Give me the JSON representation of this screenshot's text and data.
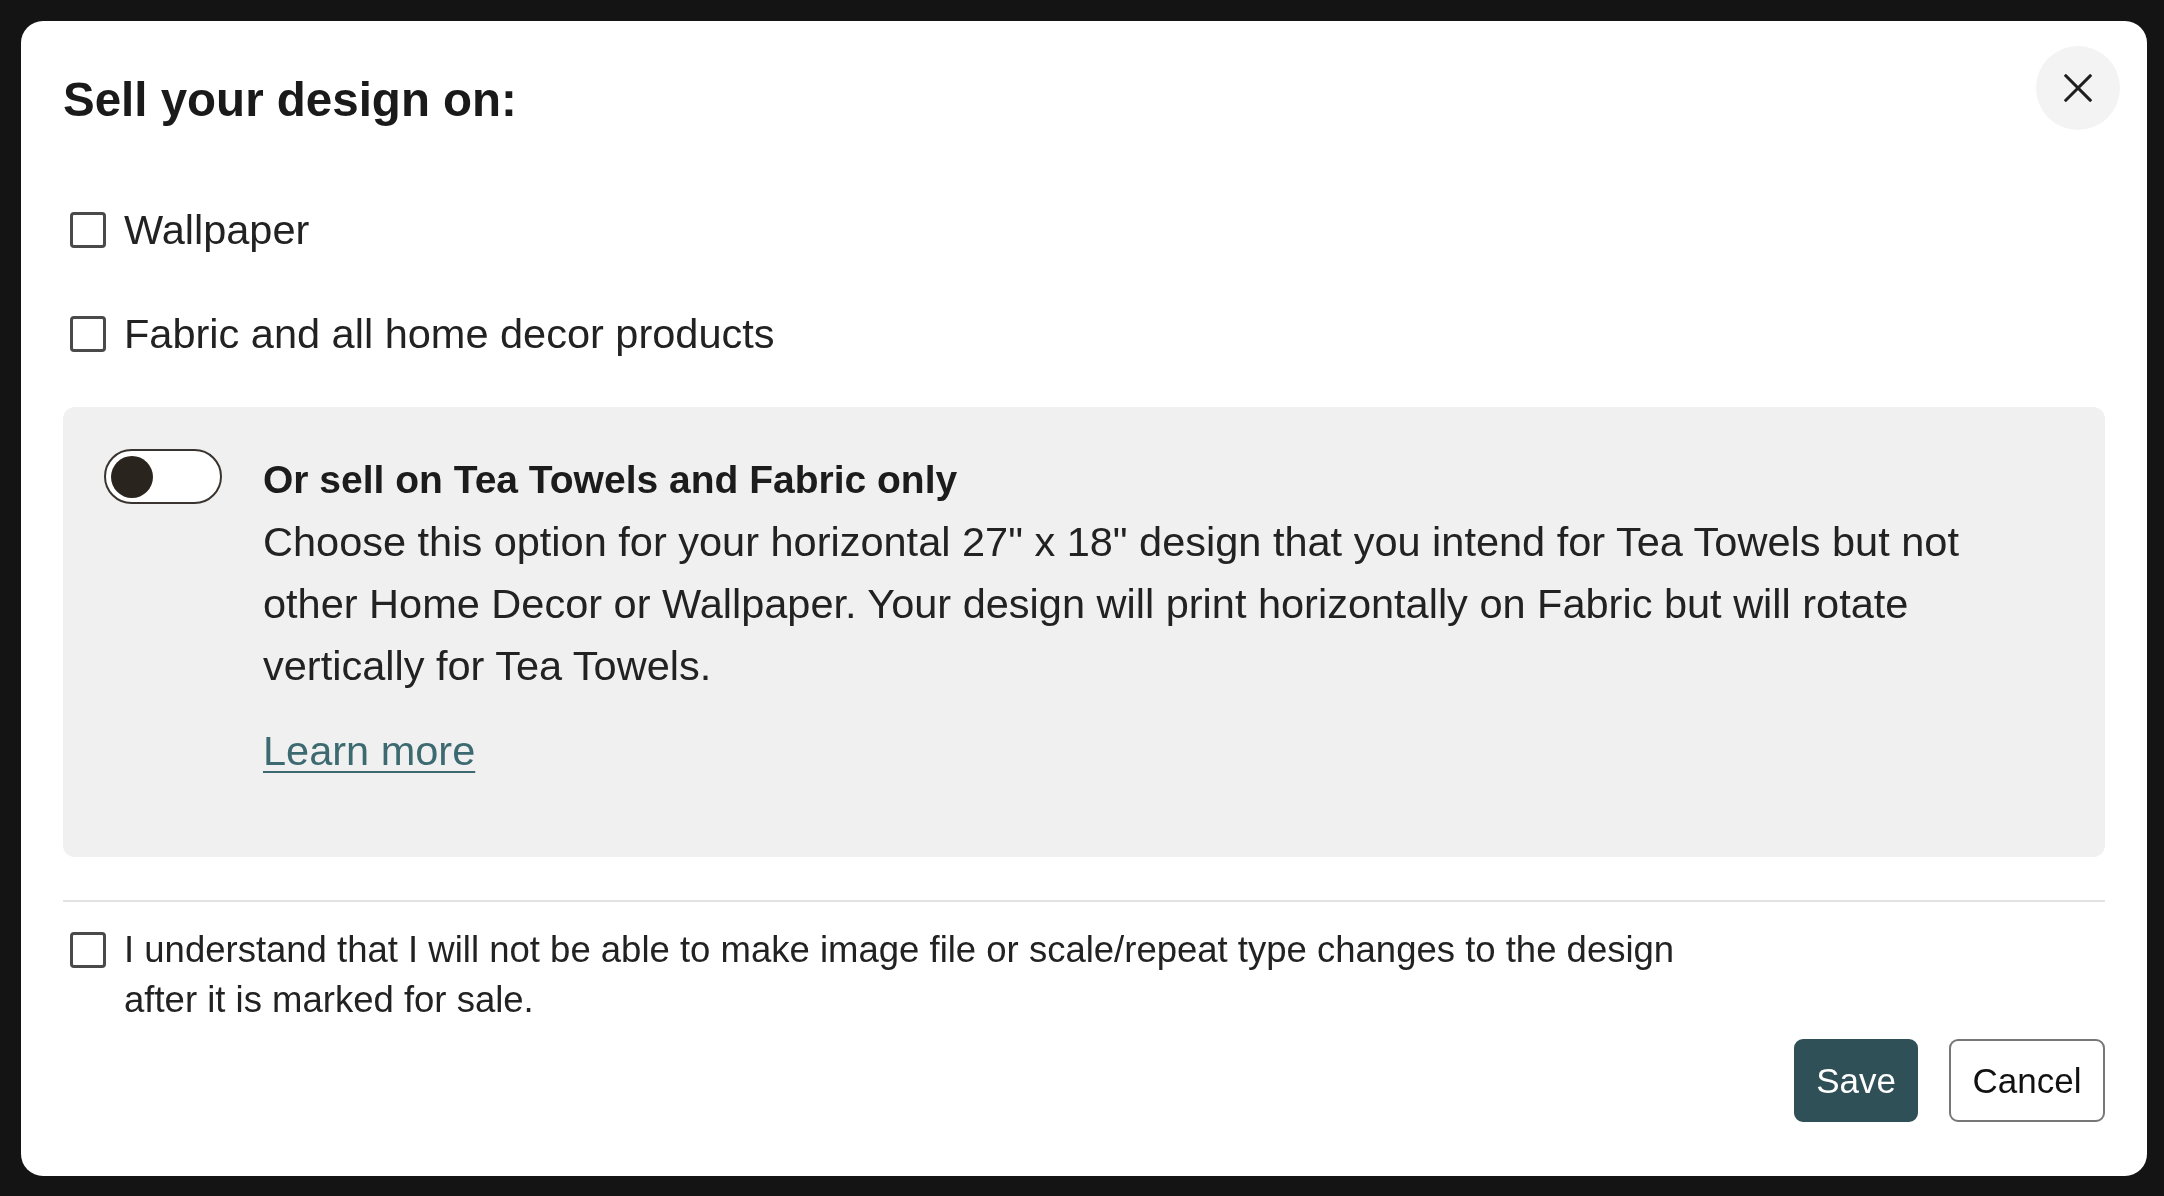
{
  "dialog": {
    "title": "Sell your design on:"
  },
  "options": [
    {
      "label": "Wallpaper",
      "checked": false
    },
    {
      "label": "Fabric and all home decor products",
      "checked": false
    }
  ],
  "tea_towel_option": {
    "on": false,
    "title": "Or sell on Tea Towels and Fabric only",
    "description": "Choose this option for your horizontal 27\" x 18\" design that you intend for Tea Towels but not other Home Decor or Wallpaper. Your design will print horizontally on Fabric but will rotate vertically for Tea Towels.",
    "link": "Learn more"
  },
  "agreement": {
    "label": "I understand that I will not be able to make image file or scale/repeat type changes to the design after it is marked for sale.",
    "checked": false
  },
  "buttons": [
    {
      "label": "Save",
      "kind": "primary"
    },
    {
      "label": "Cancel",
      "kind": "secondary"
    }
  ]
}
